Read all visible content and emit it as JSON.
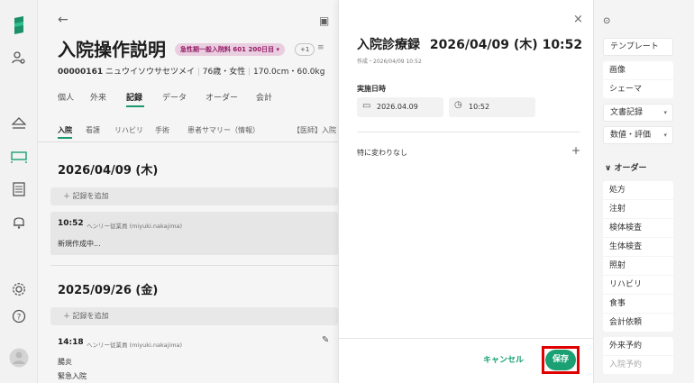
{
  "rail": {
    "icons": [
      "logo-icon",
      "user-search-icon",
      "eject-icon",
      "bed-icon",
      "document-icon",
      "bell-icon",
      "settings-icon",
      "help-icon",
      "avatar"
    ]
  },
  "patient": {
    "back": "←",
    "title": "入院操作説明",
    "badge": "急性期一般入院料 601 200日目",
    "plus_count": "+1",
    "info_id": "00000161",
    "info_kana": "ニュウイソウサセツメイ",
    "info_age": "76歳・女性",
    "info_size": "170.0cm・60.0kg",
    "tabs": [
      "個人",
      "外来",
      "記録",
      "データ",
      "オーダー",
      "会計"
    ],
    "active_tab": "記録",
    "subtabs": [
      "入院",
      "看護",
      "リハビリ",
      "手術",
      "患者サマリー（情報）",
      "【医師】入院"
    ],
    "active_subtab": "入院"
  },
  "records": [
    {
      "date": "2026/04/09 (木)",
      "add_label": "＋ 記録を追加",
      "time": "10:52",
      "author": "ヘンリー従業員 (miyuki.nakajima)",
      "body": "新規作成中..."
    },
    {
      "date": "2025/09/26 (金)",
      "add_label": "＋ 記録を追加",
      "time": "14:18",
      "author": "ヘンリー従業員 (miyuki.nakajima)",
      "body": "腸炎",
      "body2": "緊急入院"
    }
  ],
  "modal": {
    "title": "入院診療録",
    "datetime": "2026/04/09 (木) 10:52",
    "meta": "作成・2026/04/09 10:52",
    "field_label": "実施日時",
    "date_value": "2026.04.09",
    "time_value": "10:52",
    "section_label": "特に変わりなし",
    "cancel": "キャンセル",
    "save": "保存",
    "close": "×"
  },
  "sidebar": {
    "template": "テンプレート",
    "group1": [
      "画像",
      "シェーマ"
    ],
    "doc_record": "文書記録",
    "value_eval": "数値・評価",
    "order_header": "オーダー",
    "orders": [
      "処方",
      "注射",
      "検体検査",
      "生体検査",
      "照射",
      "リハビリ",
      "食事",
      "会計依頼"
    ],
    "reservations": [
      "外来予約",
      "入院予約"
    ]
  },
  "colors": {
    "accent": "#1aa073",
    "badge_bg": "#f3d7ea",
    "badge_text": "#9c1e6c",
    "highlight": "#e00000"
  }
}
